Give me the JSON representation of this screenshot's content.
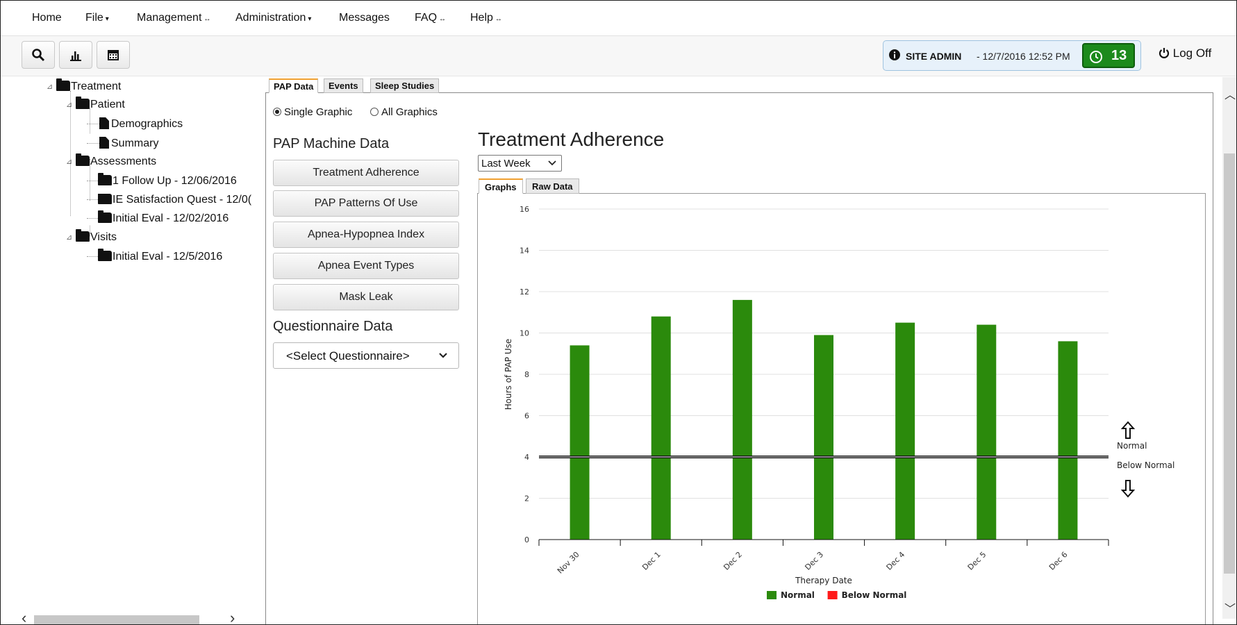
{
  "menu": {
    "home": "Home",
    "file": "File",
    "management": "Management",
    "administration": "Administration",
    "messages": "Messages",
    "faq": "FAQ",
    "help": "Help"
  },
  "toolbar": {
    "role": "SITE ADMIN",
    "datetime": "- 12/7/2016 12:52 PM",
    "timer_count": "13",
    "logoff": "Log Off"
  },
  "tree": {
    "treatment": "Treatment",
    "patient": "Patient",
    "demographics": "Demographics",
    "summary": "Summary",
    "assessments": "Assessments",
    "followup": "1 Follow Up - 12/06/2016",
    "satisfaction": "IE Satisfaction Quest - 12/0(",
    "initial_eval_assess": "Initial Eval - 12/02/2016",
    "visits": "Visits",
    "initial_eval_visit": "Initial Eval - 12/5/2016"
  },
  "tabs": {
    "pap": "PAP Data",
    "events": "Events",
    "sleep": "Sleep Studies"
  },
  "radios": {
    "single": "Single Graphic",
    "all": "All Graphics"
  },
  "pap_section": {
    "title": "PAP Machine Data",
    "buttons": [
      "Treatment Adherence",
      "PAP Patterns Of Use",
      "Apnea-Hypopnea Index",
      "Apnea Event Types",
      "Mask Leak"
    ]
  },
  "questionnaire": {
    "title": "Questionnaire Data",
    "selected": "<Select Questionnaire>"
  },
  "chart_panel": {
    "title": "Treatment Adherence",
    "range_selected": "Last Week",
    "subtabs": {
      "graphs": "Graphs",
      "raw": "Raw Data"
    }
  },
  "chart_data": {
    "type": "bar",
    "categories": [
      "Nov 30",
      "Dec 1",
      "Dec 2",
      "Dec 3",
      "Dec 4",
      "Dec 5",
      "Dec 6"
    ],
    "series": [
      {
        "name": "Normal",
        "color": "#2b8a0c",
        "values": [
          9.4,
          10.8,
          11.6,
          9.9,
          10.5,
          10.4,
          9.6
        ]
      },
      {
        "name": "Below Normal",
        "color": "#ff1a1a",
        "values": [
          0,
          0,
          0,
          0,
          0,
          0,
          0
        ]
      }
    ],
    "xlabel": "Therapy Date",
    "ylabel": "Hours of PAP Use",
    "ylim": [
      0,
      16
    ],
    "yticks": [
      0,
      2,
      4,
      6,
      8,
      10,
      12,
      14,
      16
    ],
    "threshold": 4,
    "threshold_labels": {
      "above": "Normal",
      "below": "Below Normal"
    },
    "grid": true,
    "legend_position": "bottom"
  }
}
